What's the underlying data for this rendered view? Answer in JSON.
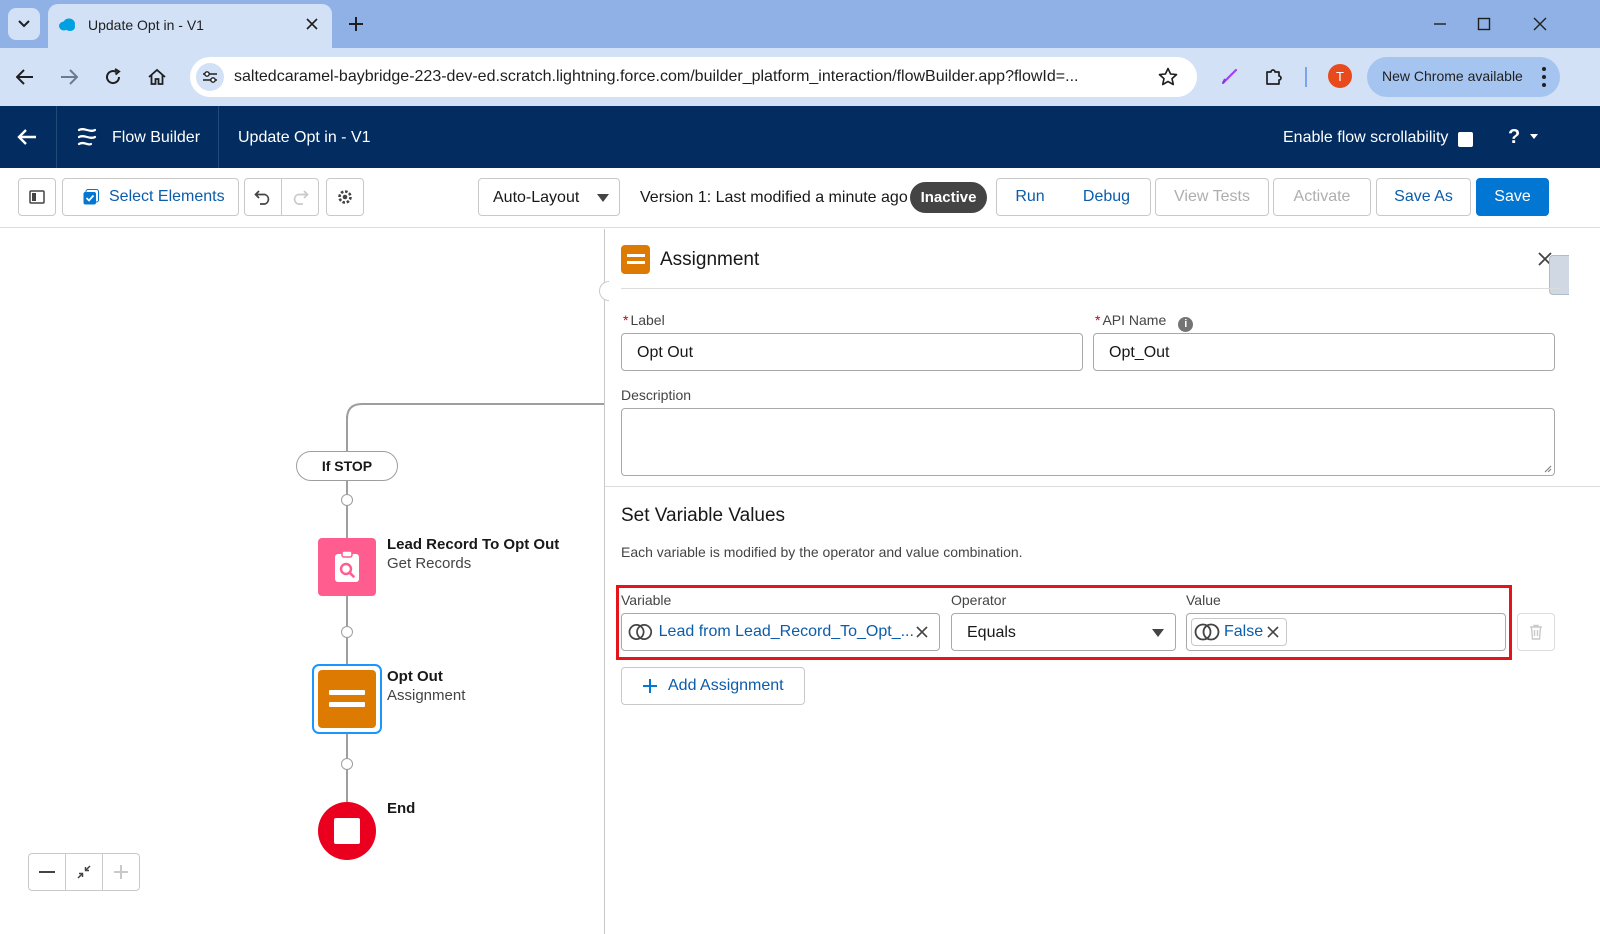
{
  "browser": {
    "tab_title": "Update Opt in - V1",
    "url": "saltedcaramel-baybridge-223-dev-ed.scratch.lightning.force.com/builder_platform_interaction/flowBuilder.app?flowId=...",
    "profile_initial": "T",
    "update_label": "New Chrome available"
  },
  "header": {
    "app_name": "Flow Builder",
    "flow_name": "Update Opt in - V1",
    "scroll_label": "Enable flow scrollability",
    "help": "?"
  },
  "toolbar": {
    "select_elements": "Select Elements",
    "layout": "Auto-Layout",
    "version_text": "Version 1: Last modified a minute ago",
    "status": "Inactive",
    "run": "Run",
    "debug": "Debug",
    "view_tests": "View Tests",
    "activate": "Activate",
    "save_as": "Save As",
    "save": "Save"
  },
  "canvas": {
    "decision_outcome": "If STOP",
    "nodes": [
      {
        "title": "Lead Record To Opt Out",
        "subtitle": "Get Records"
      },
      {
        "title": "Opt Out",
        "subtitle": "Assignment"
      },
      {
        "title": "End",
        "subtitle": ""
      }
    ]
  },
  "panel": {
    "title": "Assignment",
    "label_field": {
      "label": "Label",
      "value": "Opt Out"
    },
    "api_field": {
      "label": "API Name",
      "value": "Opt_Out"
    },
    "description_label": "Description",
    "section_title": "Set Variable Values",
    "section_desc": "Each variable is modified by the operator and value combination.",
    "row": {
      "variable_label": "Variable",
      "variable_value": "Lead from Lead_Record_To_Opt_...",
      "operator_label": "Operator",
      "operator_value": "Equals",
      "value_label": "Value",
      "value_value": "False"
    },
    "add_assignment": "Add Assignment"
  },
  "colors": {
    "header_bg": "#032d60",
    "brand": "#0176d3",
    "assignment": "#dd7a01",
    "get_records": "#ff5d8f",
    "end": "#ea001e",
    "highlight": "#e5141b"
  }
}
